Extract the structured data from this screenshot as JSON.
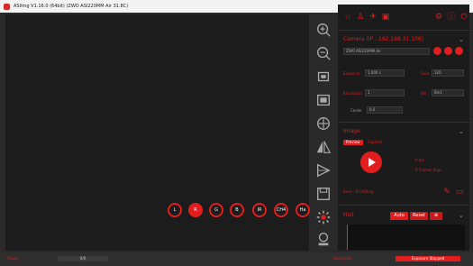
{
  "window": {
    "title": "ASIImg V1.16.0 (64bit)  (ZWO ASI220MM Air 31.8C)",
    "minimize_icon": "minimize-icon",
    "maximize_icon": "maximize-icon",
    "close_icon": "close-icon"
  },
  "toolbar": {
    "tools": [
      "zoom-in-icon",
      "zoom-out-icon",
      "fit-window-icon",
      "actual-size-icon",
      "crosshair-icon",
      "flip-horizontal-icon",
      "flip-vertical-icon",
      "save-icon",
      "brightness-icon",
      "focus-icon"
    ]
  },
  "channels": [
    {
      "label": "L",
      "selected": false
    },
    {
      "label": "R",
      "selected": true
    },
    {
      "label": "G",
      "selected": false
    },
    {
      "label": "B",
      "selected": false
    },
    {
      "label": "IR",
      "selected": false
    },
    {
      "label": "CH4",
      "selected": false
    },
    {
      "label": "Ha",
      "selected": false
    }
  ],
  "panel": {
    "top_icons": [
      "star-icon",
      "user-icon",
      "telescope-icon",
      "camera-icon",
      "settings-icon",
      "info-icon",
      "power-icon"
    ],
    "camera": {
      "title": "Camera (IP : 192.168.31.106)",
      "device": "ZWO ASI220MM Air",
      "exposure_label": "Exposure",
      "exposure_value": "1.000 s",
      "gain_label": "Gain",
      "gain_value": "120",
      "resolution_label": "Resolution",
      "resolution_value": "1",
      "bin_label": "Bin",
      "bin_value": "Bin1",
      "cooler_label": "Cooler",
      "cooler_value": "0.0"
    },
    "image": {
      "title": "Image",
      "tabs": [
        "Preview",
        "Capture"
      ],
      "fps_label": "0 fps",
      "dropped_label": "0 Frames drop",
      "file_label": "Save : D:\\ASIImg"
    },
    "histogram": {
      "title": "Hist",
      "auto_label": "Auto",
      "reset_label": "Reset"
    }
  },
  "status": {
    "progress_text": "0/0",
    "left_text": "Ready",
    "right_status": "Exposure Stopped",
    "right_text": "Histogram"
  }
}
